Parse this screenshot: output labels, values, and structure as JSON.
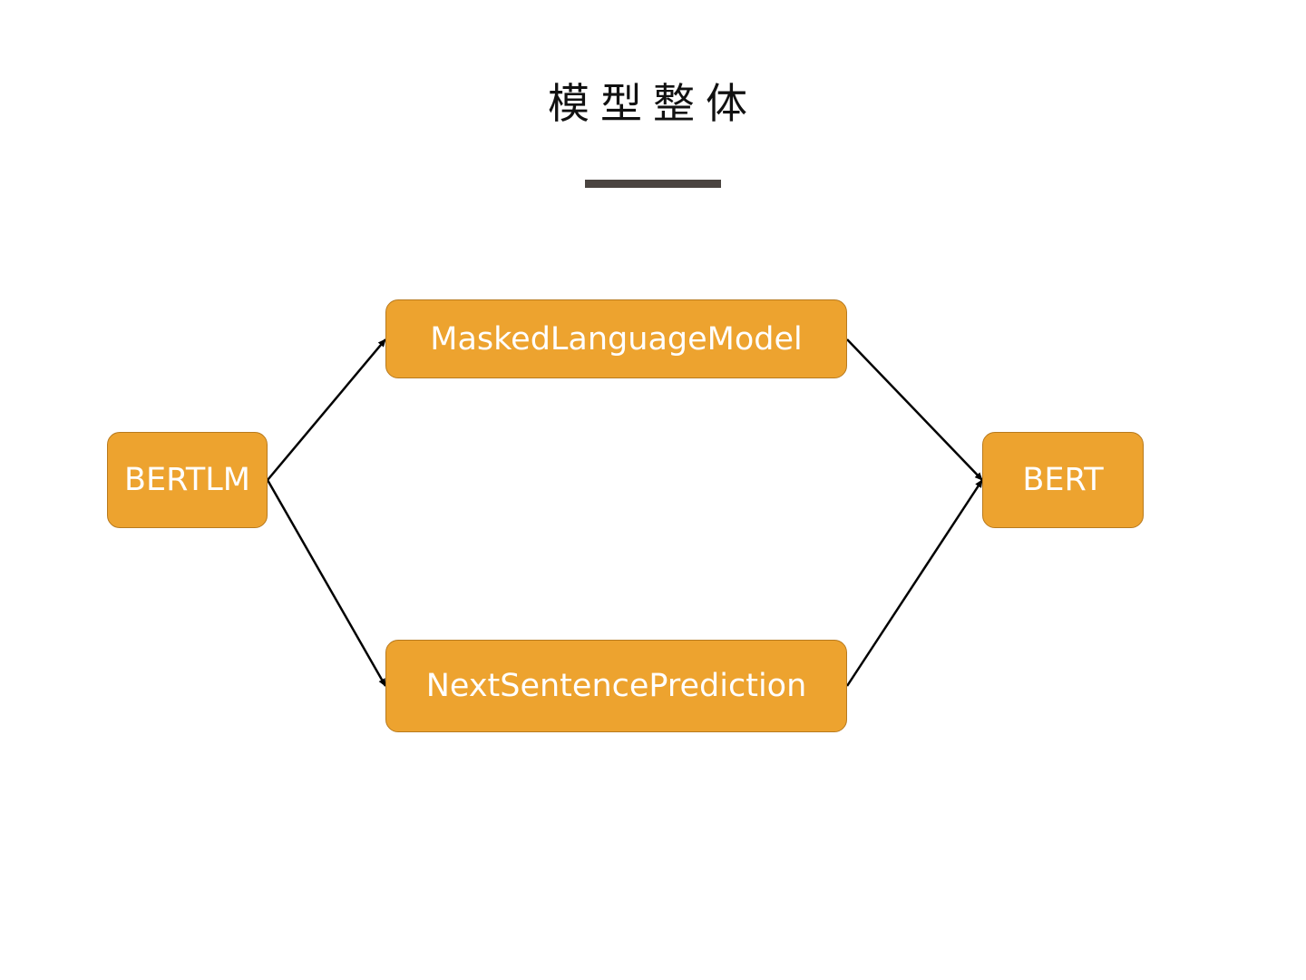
{
  "title": "模型整体",
  "colors": {
    "node_fill": "#eda32f",
    "node_text": "#ffffff",
    "title_bar": "#4a4440",
    "arrow": "#000000"
  },
  "nodes": {
    "bertlm": "BERTLM",
    "mlm": "MaskedLanguageModel",
    "nsp": "NextSentencePrediction",
    "bert": "BERT"
  },
  "edges": [
    {
      "from": "BERTLM",
      "to": "MaskedLanguageModel"
    },
    {
      "from": "BERTLM",
      "to": "NextSentencePrediction"
    },
    {
      "from": "MaskedLanguageModel",
      "to": "BERT"
    },
    {
      "from": "NextSentencePrediction",
      "to": "BERT"
    }
  ]
}
